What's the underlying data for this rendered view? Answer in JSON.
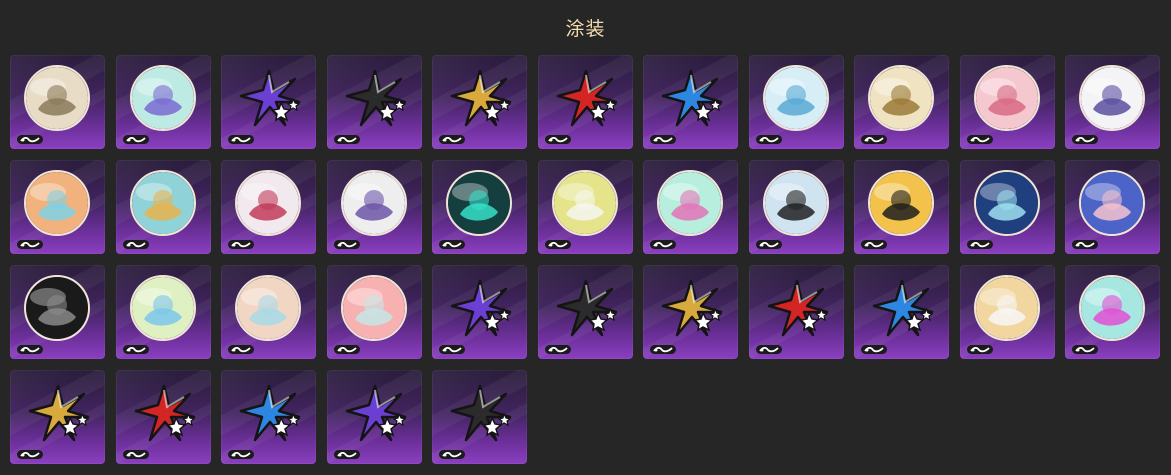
{
  "page": {
    "title": "涂装"
  },
  "tiles": [
    {
      "kind": "disc",
      "icon": "character-portrait-icon",
      "bg": "#e9dcc6",
      "fg": "#8a7a5a"
    },
    {
      "kind": "disc",
      "icon": "marble-swirl-icon",
      "bg": "#bdebe3",
      "fg": "#7a6bd2"
    },
    {
      "kind": "star",
      "icon": "purple-star-icon",
      "color": "#6b3fd3"
    },
    {
      "kind": "star",
      "icon": "black-star-icon",
      "color": "#2b2b2b"
    },
    {
      "kind": "star",
      "icon": "gold-star-icon",
      "color": "#d8a93c"
    },
    {
      "kind": "star",
      "icon": "red-star-icon",
      "color": "#d42525"
    },
    {
      "kind": "star",
      "icon": "blue-star-icon",
      "color": "#2d86e0"
    },
    {
      "kind": "disc",
      "icon": "wave-orb-icon",
      "bg": "#d8eef7",
      "fg": "#5aa9d6"
    },
    {
      "kind": "disc",
      "icon": "gold-emblem-icon",
      "bg": "#f0e3c2",
      "fg": "#9b7a37"
    },
    {
      "kind": "disc",
      "icon": "pink-portrait-icon",
      "bg": "#f5c7cf",
      "fg": "#d86a86"
    },
    {
      "kind": "disc",
      "icon": "winged-crest-icon",
      "bg": "#f4f4f6",
      "fg": "#5b4fa0"
    },
    {
      "kind": "disc",
      "icon": "crystal-shard-icon",
      "bg": "#f2b27d",
      "fg": "#7fd1e6"
    },
    {
      "kind": "disc",
      "icon": "chibi-character-icon",
      "bg": "#8fd3d8",
      "fg": "#e7b34c"
    },
    {
      "kind": "disc",
      "icon": "stripe-swirl-icon",
      "bg": "#f2e9ef",
      "fg": "#c23b5a"
    },
    {
      "kind": "disc",
      "icon": "moon-eye-icon",
      "bg": "#eeeeee",
      "fg": "#6b55a8"
    },
    {
      "kind": "disc",
      "icon": "teal-knot-icon",
      "bg": "#153f3f",
      "fg": "#35e0c8"
    },
    {
      "kind": "disc",
      "icon": "bunny-character-icon",
      "bg": "#e5e48a",
      "fg": "#f6f6f0"
    },
    {
      "kind": "disc",
      "icon": "sparkle-bubble-icon",
      "bg": "#b7eedd",
      "fg": "#e274b7"
    },
    {
      "kind": "disc",
      "icon": "penguin-icon",
      "bg": "#cfe3f1",
      "fg": "#222222"
    },
    {
      "kind": "disc",
      "icon": "cow-pattern-icon",
      "bg": "#f3c24a",
      "fg": "#1e1e1e"
    },
    {
      "kind": "disc",
      "icon": "landscape-dome-icon",
      "bg": "#1f3f7e",
      "fg": "#9fe0f0"
    },
    {
      "kind": "disc",
      "icon": "pink-girl-icon",
      "bg": "#4c63c8",
      "fg": "#f4c2cf"
    },
    {
      "kind": "disc",
      "icon": "dark-house-icon",
      "bg": "#1a1a1a",
      "fg": "#8a8a8a"
    },
    {
      "kind": "disc",
      "icon": "swimming-fish-icon",
      "bg": "#dff1c2",
      "fg": "#7bc7ea"
    },
    {
      "kind": "disc",
      "icon": "ghost-cat-icon",
      "bg": "#f2d6c4",
      "fg": "#a8d9e7"
    },
    {
      "kind": "disc",
      "icon": "angel-cat-icon",
      "bg": "#f7b1b1",
      "fg": "#c6e6e6"
    },
    {
      "kind": "star",
      "icon": "purple-star-icon",
      "color": "#6b3fd3"
    },
    {
      "kind": "star",
      "icon": "black-star-icon",
      "color": "#2b2b2b"
    },
    {
      "kind": "star",
      "icon": "gold-star-icon",
      "color": "#d8a93c"
    },
    {
      "kind": "star",
      "icon": "red-star-icon",
      "color": "#d42525"
    },
    {
      "kind": "star",
      "icon": "blue-star-icon",
      "color": "#2d86e0"
    },
    {
      "kind": "disc",
      "icon": "white-character-icon",
      "bg": "#f1d6a0",
      "fg": "#f7f7f7"
    },
    {
      "kind": "disc",
      "icon": "pink-cat-icon",
      "bg": "#a6e8e1",
      "fg": "#e24fd4"
    },
    {
      "kind": "star",
      "icon": "gold-star-icon",
      "color": "#d8a93c"
    },
    {
      "kind": "star",
      "icon": "red-star-icon",
      "color": "#d42525"
    },
    {
      "kind": "star",
      "icon": "blue-star-icon",
      "color": "#2d86e0"
    },
    {
      "kind": "star",
      "icon": "purple-star-icon",
      "color": "#6b3fd3"
    },
    {
      "kind": "star",
      "icon": "black-star-icon",
      "color": "#2b2b2b"
    }
  ]
}
